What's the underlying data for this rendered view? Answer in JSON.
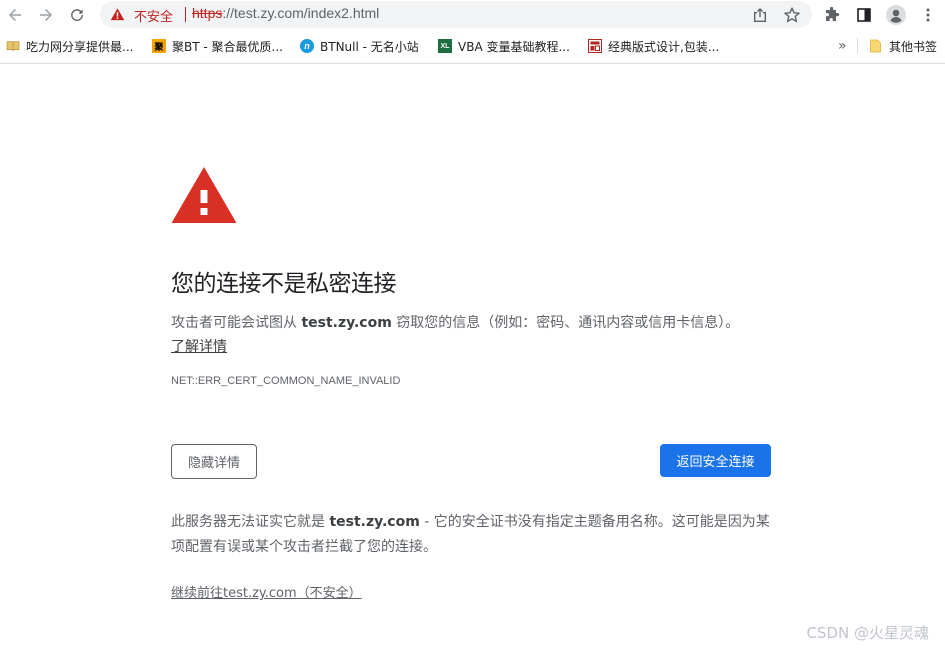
{
  "toolbar": {
    "back_icon": "arrow-left-icon",
    "forward_icon": "arrow-right-icon",
    "reload_icon": "reload-icon",
    "omnibox": {
      "security_label": "不安全",
      "url_scheme": "https",
      "url_rest": "://test.zy.com/index2.html"
    },
    "icons": [
      "share-icon",
      "star-icon",
      "extensions-icon",
      "side-panel-icon",
      "profile-icon",
      "more-icon"
    ]
  },
  "bookmarks": {
    "items": [
      {
        "label": "吃力网分享提供最...",
        "icon": "book-icon"
      },
      {
        "label": "聚BT - 聚合最优质...",
        "icon": "ju-icon",
        "icon_text": "聚"
      },
      {
        "label": "BTNull - 无名小站",
        "icon": "n-icon",
        "icon_text": "n"
      },
      {
        "label": "VBA 变量基础教程...",
        "icon": "xl-icon",
        "icon_text": "XL"
      },
      {
        "label": "经典版式设计,包装...",
        "icon": "layout-icon"
      }
    ],
    "overflow": "»",
    "other_folder": "其他书签"
  },
  "interstitial": {
    "heading": "您的连接不是私密连接",
    "explanation_prefix": "攻击者可能会试图从 ",
    "explanation_host": "test.zy.com",
    "explanation_suffix": " 窃取您的信息（例如：密码、通讯内容或信用卡信息）。",
    "learn_more": "了解详情",
    "error_code": "NET::ERR_CERT_COMMON_NAME_INVALID",
    "details_button": "隐藏详情",
    "back_button": "返回安全连接",
    "details_prefix": "此服务器无法证实它就是 ",
    "details_host": "test.zy.com",
    "details_suffix": " - 它的安全证书没有指定主题备用名称。这可能是因为某项配置有误或某个攻击者拦截了您的连接。",
    "proceed_link": "继续前往test.zy.com（不安全）"
  },
  "watermark": "CSDN @火星灵魂",
  "colors": {
    "danger": "#c5221f",
    "warning_triangle": "#d93025",
    "primary_button": "#1a73e8"
  }
}
